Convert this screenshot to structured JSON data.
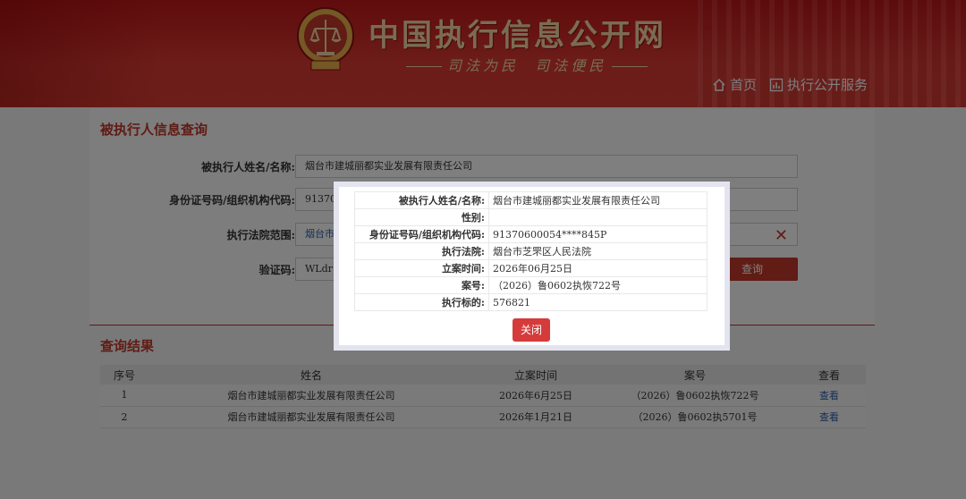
{
  "header": {
    "site_title": "中国执行信息公开网",
    "slogan_left": "司法为民",
    "slogan_right": "司法便民",
    "nav": [
      {
        "label": "首页",
        "icon": "home-icon"
      },
      {
        "label": "执行公开服务",
        "icon": "chart-icon"
      }
    ]
  },
  "query_panel": {
    "title": "被执行人信息查询",
    "name_label": "被执行人姓名/名称:",
    "name_value": "烟台市建城丽都实业发展有限责任公司",
    "id_label": "身份证号码/组织机构代码:",
    "id_value": "9137060",
    "court_label": "执行法院范围:",
    "court_value": "烟台市",
    "captcha_label": "验证码:",
    "captcha_value": "WLdr",
    "query_button": "查询"
  },
  "results": {
    "title": "查询结果",
    "columns": [
      "序号",
      "姓名",
      "立案时间",
      "案号",
      "查看"
    ],
    "rows": [
      {
        "no": "1",
        "name": "烟台市建城丽都实业发展有限责任公司",
        "date": "2026年6月25日",
        "case": "（2026）鲁0602执恢722号",
        "view": "查看"
      },
      {
        "no": "2",
        "name": "烟台市建城丽都实业发展有限责任公司",
        "date": "2026年1月21日",
        "case": "（2026）鲁0602执5701号",
        "view": "查看"
      }
    ]
  },
  "modal": {
    "rows": [
      {
        "key": "被执行人姓名/名称:",
        "value": "烟台市建城丽都实业发展有限责任公司"
      },
      {
        "key": "性别:",
        "value": ""
      },
      {
        "key": "身份证号码/组织机构代码:",
        "value": "91370600054****845P"
      },
      {
        "key": "执行法院:",
        "value": "烟台市芝罘区人民法院"
      },
      {
        "key": "立案时间:",
        "value": "2026年06月25日"
      },
      {
        "key": "案号:",
        "value": "（2026）鲁0602执恢722号"
      },
      {
        "key": "执行标的:",
        "value": "576821"
      }
    ],
    "close_button": "关闭"
  },
  "colors": {
    "brand_red": "#c0392b",
    "header_gold": "#f5d9a6",
    "link_blue": "#2c5fa8"
  }
}
